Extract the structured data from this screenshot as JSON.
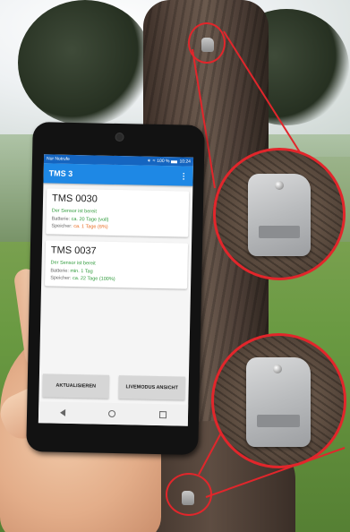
{
  "app": {
    "status_bar": {
      "left": "Nur Notrufe",
      "battery": "100 %",
      "time": "10:24"
    },
    "title": "TMS 3",
    "menu_icon": "more-vert-icon"
  },
  "sensors": [
    {
      "name": "TMS 0030",
      "status": "Der Sensor ist bereit",
      "battery_label": "Batterie:",
      "battery_value": "ca. 20 Tage (voll)",
      "storage_label": "Speicher:",
      "storage_value": "ca. 1 Tage (6%)"
    },
    {
      "name": "TMS 0037",
      "status": "Der Sensor ist bereit",
      "battery_label": "Batterie:",
      "battery_value": "min. 1 Tag",
      "storage_label": "Speicher:",
      "storage_value": "ca. 22 Tage (100%)"
    }
  ],
  "buttons": {
    "refresh": "AKTUALISIEREN",
    "live": "LIVEMODUS ANSICHT"
  },
  "colors": {
    "app_bar": "#1e88e5",
    "status_bar": "#1565c0",
    "ok_green": "#2e9a3a",
    "warn_orange": "#e86a1f",
    "callout_red": "#e1262b"
  }
}
